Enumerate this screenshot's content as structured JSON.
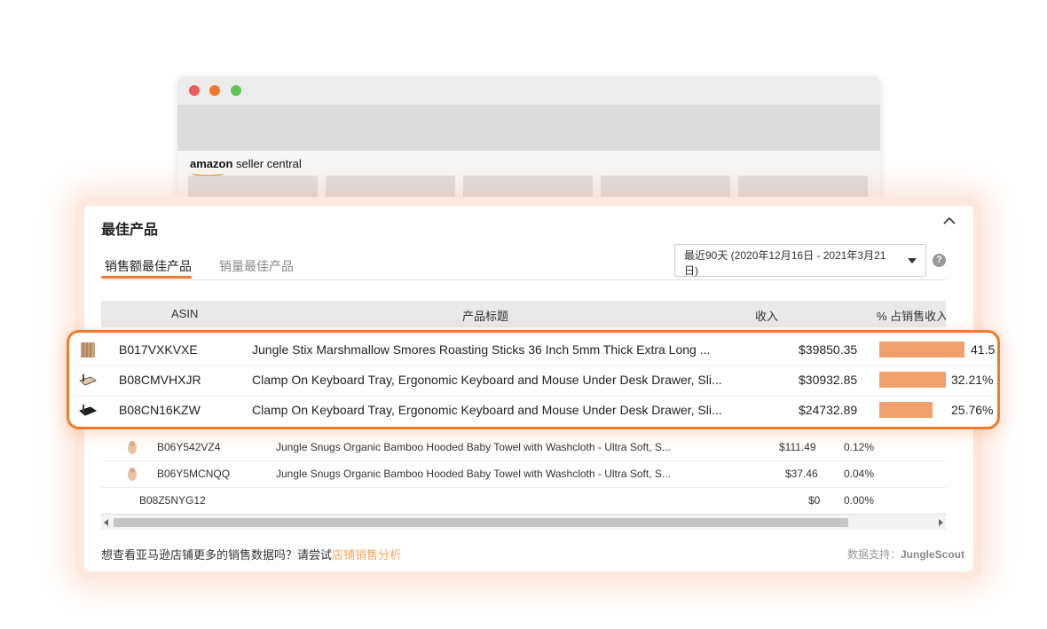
{
  "browser": {
    "logo_amazon": "amazon",
    "logo_rest": " seller central"
  },
  "card": {
    "title": "最佳产品",
    "tabs": [
      {
        "label": "销售额最佳产品",
        "active": true
      },
      {
        "label": "销量最佳产品",
        "active": false
      }
    ],
    "date_range": "最近90天 (2020年12月16日 - 2021年3月21日)",
    "help_symbol": "?"
  },
  "table": {
    "headers": {
      "asin": "ASIN",
      "title": "产品标题",
      "revenue": "收入",
      "share": "% 占销售收入"
    },
    "highlighted_rows": [
      {
        "asin": "B017VXKVXE",
        "title": "Jungle Stix Marshmallow Smores Roasting Sticks 36 Inch 5mm Thick Extra Long ...",
        "revenue": "$39850.35",
        "share": "41.5",
        "share_value": 41.5,
        "icon": "roasting-sticks-thumb"
      },
      {
        "asin": "B08CMVHXJR",
        "title": "Clamp On Keyboard Tray, Ergonomic Keyboard and Mouse Under Desk Drawer, Sli...",
        "revenue": "$30932.85",
        "share": "32.21%",
        "share_value": 32.21,
        "icon": "keyboard-tray-thumb"
      },
      {
        "asin": "B08CN16KZW",
        "title": "Clamp On Keyboard Tray, Ergonomic Keyboard and Mouse Under Desk Drawer, Sli...",
        "revenue": "$24732.89",
        "share": "25.76%",
        "share_value": 25.76,
        "icon": "keyboard-tray-black-thumb"
      }
    ],
    "rows": [
      {
        "asin": "B06Y542VZ4",
        "title": "Jungle Snugs Organic Bamboo Hooded Baby Towel with Washcloth - Ultra Soft, S...",
        "revenue": "$111.49",
        "share": "0.12%",
        "icon": "baby-towel-thumb"
      },
      {
        "asin": "B06Y5MCNQQ",
        "title": "Jungle Snugs Organic Bamboo Hooded Baby Towel with Washcloth - Ultra Soft, S...",
        "revenue": "$37.46",
        "share": "0.04%",
        "icon": "baby-towel-thumb"
      },
      {
        "asin": "B08Z5NYG12",
        "title": "",
        "revenue": "$0",
        "share": "0.00%",
        "icon": ""
      }
    ]
  },
  "footer": {
    "prompt": "想查看亚马逊店铺更多的销售数据吗？请尝试",
    "link": "店铺销售分析",
    "credit_label": "数据支持：",
    "credit_brand": "JungleScout"
  },
  "colors": {
    "accent": "#f07c27",
    "bar": "#f0a06a",
    "link": "#f4a55c"
  }
}
